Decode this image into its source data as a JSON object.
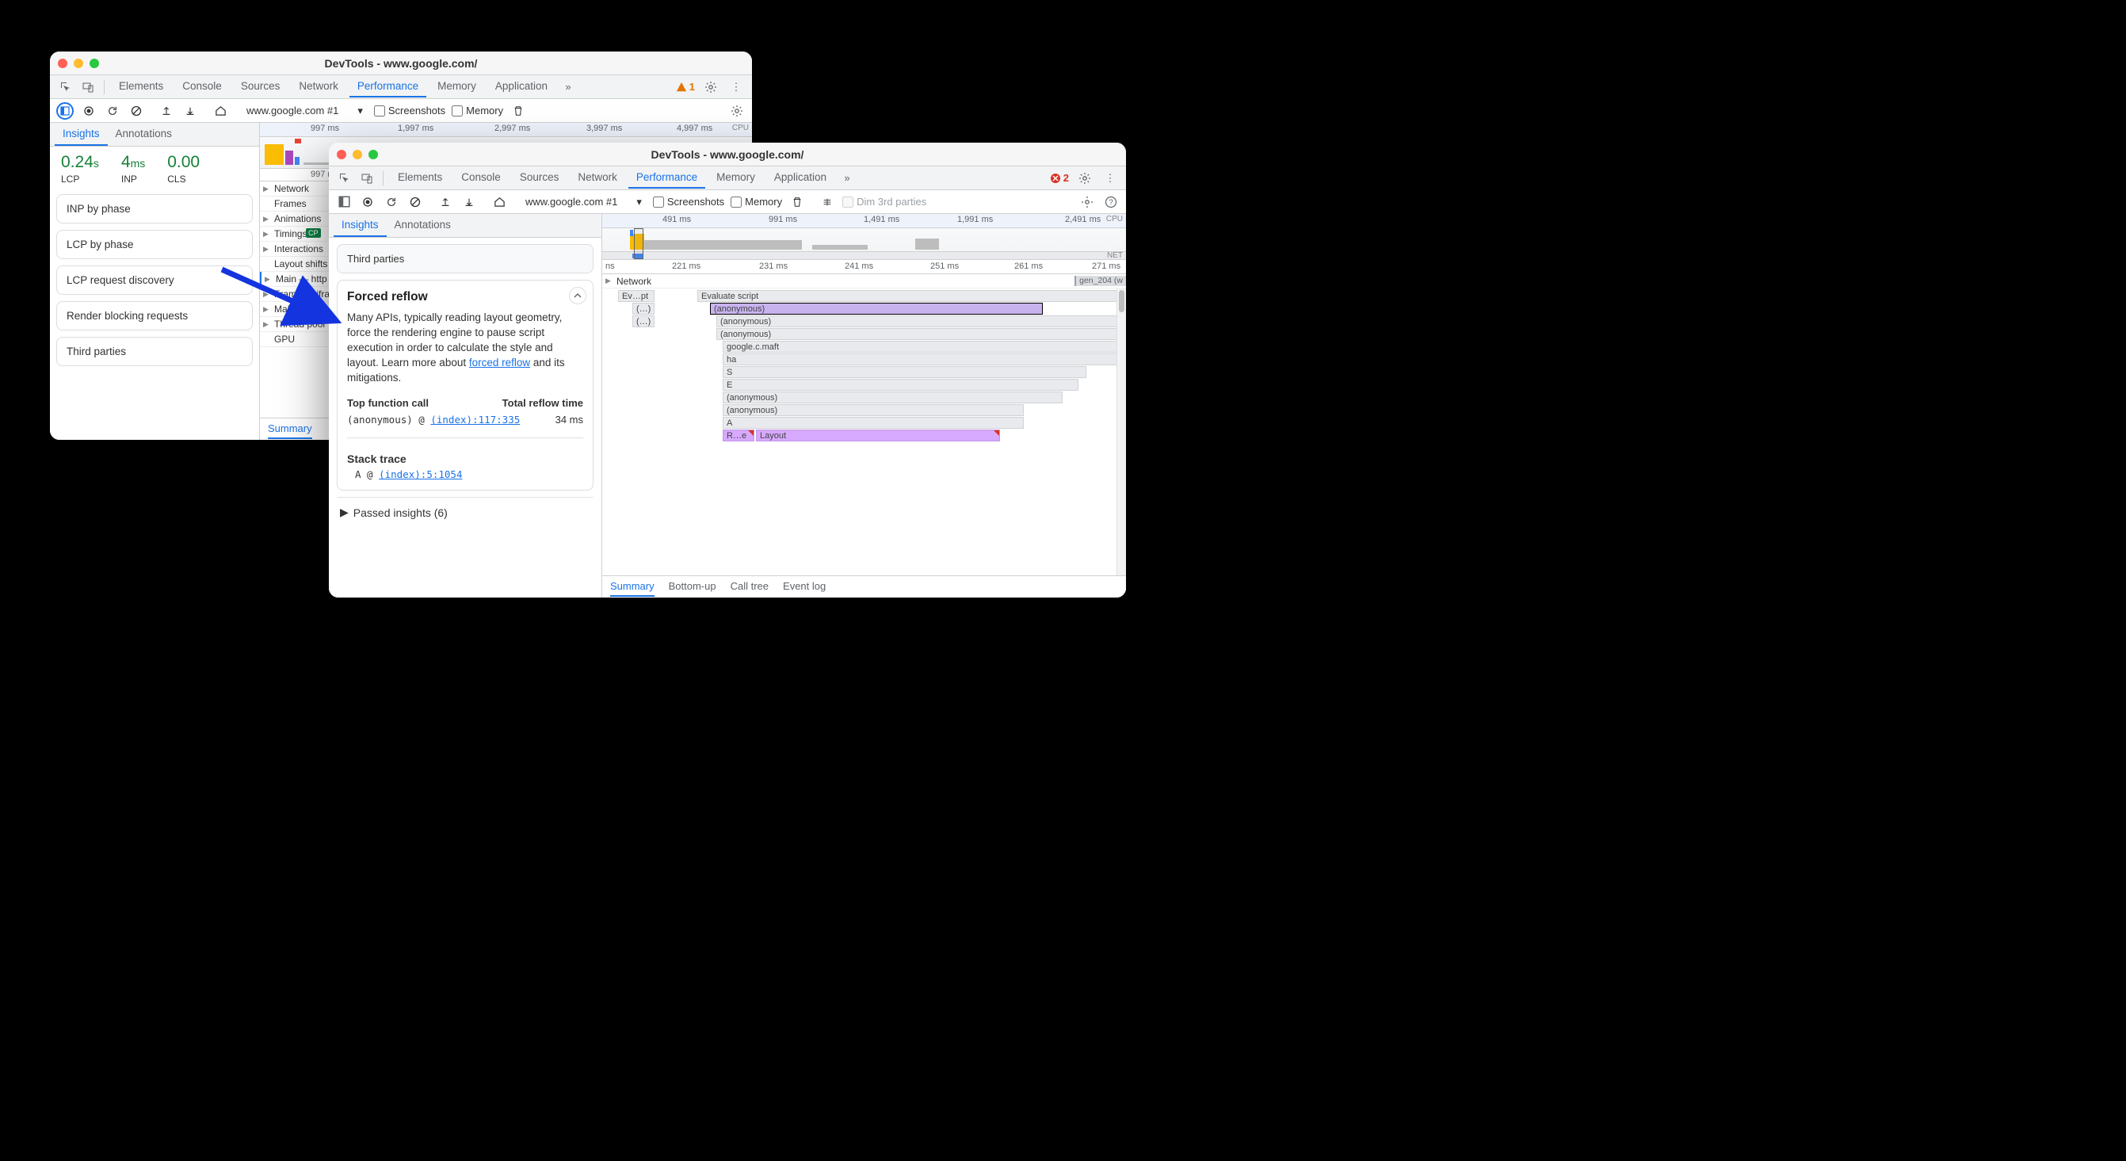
{
  "win1": {
    "title": "DevTools - www.google.com/",
    "tabs": [
      "Elements",
      "Console",
      "Sources",
      "Network",
      "Performance",
      "Memory",
      "Application"
    ],
    "active_tab": "Performance",
    "warn_count": "1",
    "perf_url": "www.google.com #1",
    "chk_screenshots": "Screenshots",
    "chk_memory": "Memory",
    "side_tabs": [
      "Insights",
      "Annotations"
    ],
    "side_active": "Insights",
    "metrics": [
      {
        "value": "0.24",
        "unit": "s",
        "label": "LCP"
      },
      {
        "value": "4",
        "unit": "ms",
        "label": "INP"
      },
      {
        "value": "0.00",
        "unit": "",
        "label": "CLS"
      }
    ],
    "insight_cards": [
      "INP by phase",
      "LCP by phase",
      "LCP request discovery",
      "Render blocking requests",
      "Third parties"
    ],
    "ruler_ticks": [
      "997 ms",
      "1,997 ms",
      "2,997 ms",
      "3,997 ms",
      "4,997 ms"
    ],
    "ruler_side": "CPU",
    "tracks": [
      "Network",
      "Frames",
      "Animations",
      "Timings",
      "Interactions",
      "Layout shifts",
      "Main — http",
      "Frame — iframe",
      "Main — abc",
      "Thread pool",
      "GPU"
    ],
    "timings_badges": [
      "CP"
    ],
    "footer_active": "Summary",
    "second_ruler_tick": "997 ms"
  },
  "win2": {
    "title": "DevTools - www.google.com/",
    "tabs": [
      "Elements",
      "Console",
      "Sources",
      "Network",
      "Performance",
      "Memory",
      "Application"
    ],
    "active_tab": "Performance",
    "err_count": "2",
    "perf_url": "www.google.com #1",
    "chk_screenshots": "Screenshots",
    "chk_memory": "Memory",
    "dim_label": "Dim 3rd parties",
    "side_tabs": [
      "Insights",
      "Annotations"
    ],
    "side_active": "Insights",
    "third_parties_card": "Third parties",
    "detail": {
      "title": "Forced reflow",
      "desc_pre": "Many APIs, typically reading layout geometry, force the rendering engine to pause script execution in order to calculate the style and layout. Learn more about ",
      "link_text": "forced reflow",
      "desc_post": " and its mitigations.",
      "table_headers": [
        "Top function call",
        "Total reflow time"
      ],
      "fn_name": "(anonymous) @ ",
      "fn_loc": "(index):117:335",
      "reflow_time": "34 ms",
      "stack_label": "Stack trace",
      "stack_fn": "A @ ",
      "stack_loc": "(index):5:1054"
    },
    "passed_label": "Passed insights (6)",
    "minimap_ticks": [
      "491 ms",
      "991 ms",
      "1,491 ms",
      "1,991 ms",
      "2,491 ms"
    ],
    "minimap_side_cpu": "CPU",
    "minimap_side_net": "NET",
    "ruler2_ticks": [
      "ns",
      "221 ms",
      "231 ms",
      "241 ms",
      "251 ms",
      "261 ms",
      "271 ms"
    ],
    "network_track": "Network",
    "network_bar": "gen_204 (w",
    "flame": {
      "col0": [
        "Ev…pt",
        "(…)",
        "(…)"
      ],
      "col1_label": "Evaluate script",
      "rows": [
        "(anonymous)",
        "(anonymous)",
        "(anonymous)",
        "google.c.maft",
        "ha",
        "S",
        "E",
        "(anonymous)",
        "(anonymous)",
        "A"
      ],
      "last_row_left": "R…e",
      "last_row_right": "Layout"
    },
    "footer_tabs": [
      "Summary",
      "Bottom-up",
      "Call tree",
      "Event log"
    ],
    "footer_active": "Summary"
  }
}
